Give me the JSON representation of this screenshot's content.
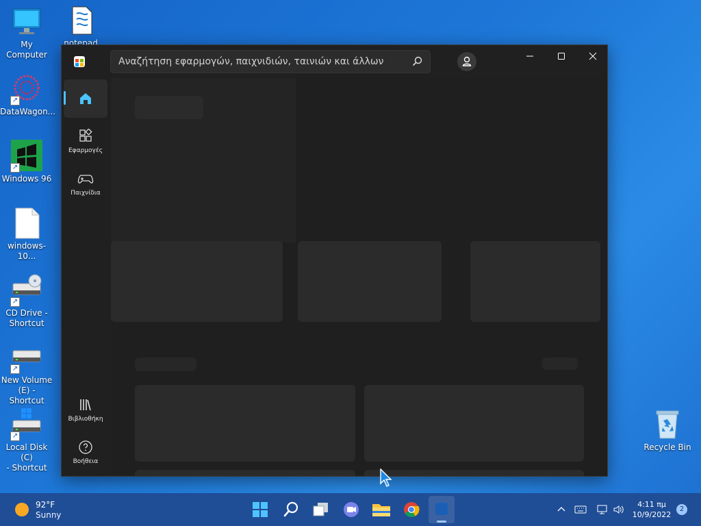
{
  "desktop": {
    "icons": [
      {
        "label": "My Computer"
      },
      {
        "label": "notepad"
      },
      {
        "label": "DataWagon..."
      },
      {
        "label": "Windows 96"
      },
      {
        "label": "windows-10..."
      },
      {
        "label": "CD Drive -\nShortcut"
      },
      {
        "label": "New Volume\n(E) - Shortcut"
      },
      {
        "label": "Local Disk (C)\n- Shortcut"
      },
      {
        "label": "Recycle Bin"
      }
    ]
  },
  "store": {
    "search_placeholder": "Αναζήτηση εφαρμογών, παιχνιδιών, ταινιών και άλλων",
    "nav": {
      "home": "",
      "apps": "Εφαρμογές",
      "games": "Παιχνίδια",
      "library": "Βιβλιοθήκη",
      "help": "Βοήθεια"
    },
    "accent": "#4cc2ff"
  },
  "taskbar": {
    "weather": {
      "temp": "92°F",
      "condition": "Sunny"
    },
    "clock": {
      "time": "4:11 πμ",
      "date": "10/9/2022"
    },
    "notification_count": "2",
    "color": "#1f4d96"
  }
}
